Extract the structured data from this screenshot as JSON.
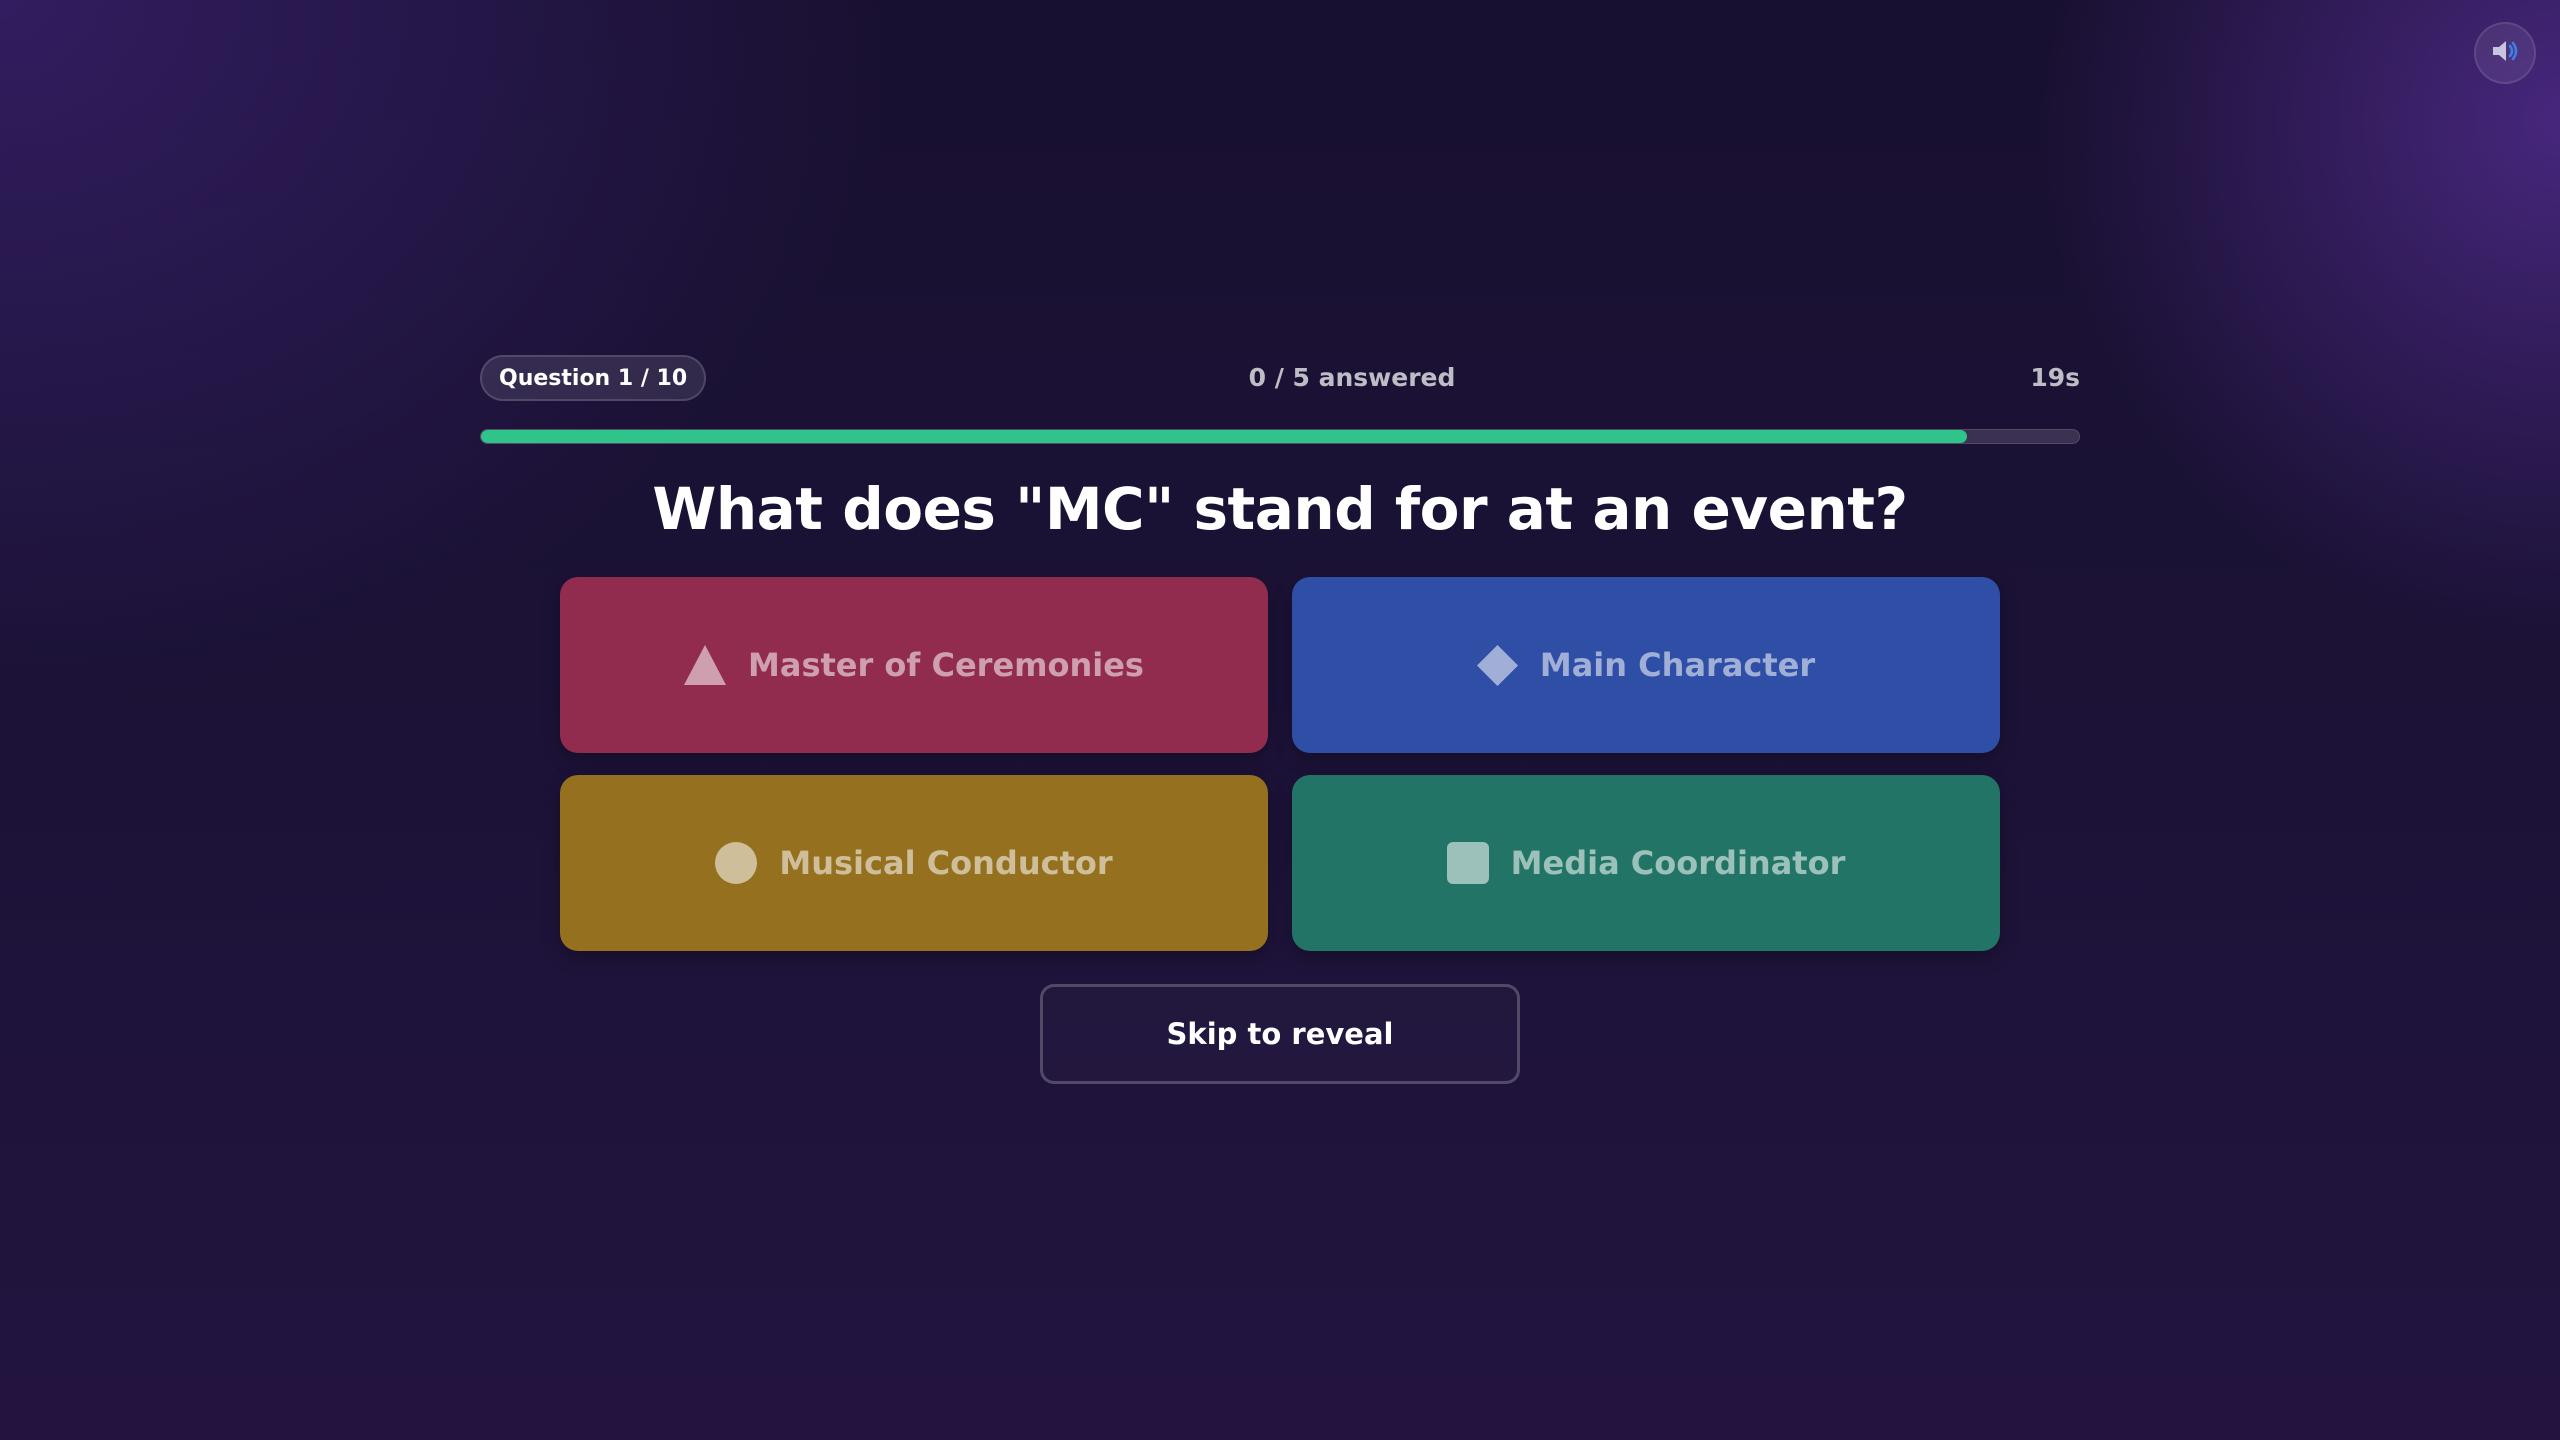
{
  "header": {
    "question_badge": "Question 1 / 10",
    "answered": "0 / 5 answered",
    "timer": "19s",
    "sound_icon": "speaker-volume-icon"
  },
  "progress": {
    "time_remaining_fraction": 0.93,
    "fill_color": "#2ec48a"
  },
  "question": {
    "text": "What does \"MC\" stand for at an event?"
  },
  "answers": [
    {
      "label": "Master of Ceremonies",
      "icon": "triangle-icon",
      "color": "#922c4e"
    },
    {
      "label": "Main Character",
      "icon": "diamond-icon",
      "color": "#2f4fa7"
    },
    {
      "label": "Musical Conductor",
      "icon": "circle-icon",
      "color": "#94701f"
    },
    {
      "label": "Media Coordinator",
      "icon": "square-icon",
      "color": "#227566"
    }
  ],
  "actions": {
    "skip_label": "Skip to reveal"
  }
}
